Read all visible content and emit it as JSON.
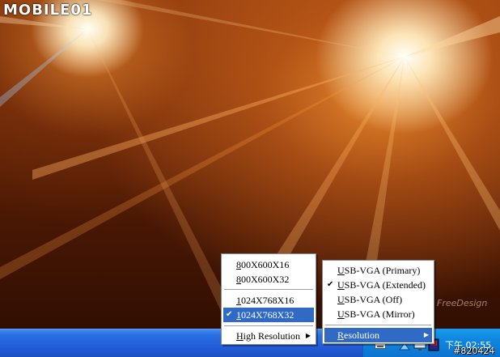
{
  "branding": {
    "logo_text": "MOBILE01",
    "watermark_text": "FreeDesign",
    "id_badge": "#820424"
  },
  "taskbar": {
    "clock": "下午 02:55",
    "tray_icons": [
      "keyboard-icon",
      "network-icon",
      "display-icon",
      "monitor-icon"
    ]
  },
  "resolution_menu": {
    "items": [
      {
        "label": "800X600X16",
        "accel": "8",
        "rest": "00X600X16",
        "checked": false
      },
      {
        "label": "800X600X32",
        "accel": "8",
        "rest": "00X600X32",
        "checked": false
      },
      {
        "label": "1024X768X16",
        "accel": "1",
        "rest": "024X768X16",
        "checked": false
      },
      {
        "label": "1024X768X32",
        "accel": "1",
        "rest": "024X768X32",
        "checked": true,
        "highlighted": true
      }
    ],
    "high_resolution": {
      "label": "High Resolution",
      "accel": "H",
      "rest": "igh Resolution"
    }
  },
  "main_menu": {
    "items": [
      {
        "label": "USB-VGA (Primary)",
        "accel": "U",
        "rest": "SB-VGA (Primary)",
        "checked": false
      },
      {
        "label": "USB-VGA (Extended)",
        "accel": "U",
        "rest": "SB-VGA (Extended)",
        "checked": true
      },
      {
        "label": "USB-VGA (Off)",
        "accel": "U",
        "rest": "SB-VGA (Off)",
        "checked": false
      },
      {
        "label": "USB-VGA (Mirror)",
        "accel": "U",
        "rest": "SB-VGA (Mirror)",
        "checked": false
      }
    ],
    "resolution": {
      "label": "Resolution",
      "accel": "R",
      "rest": "esolution",
      "highlighted": true
    }
  },
  "colors": {
    "menu_highlight": "#316ac5",
    "taskbar": "#245edb",
    "tray": "#0f86e0"
  }
}
